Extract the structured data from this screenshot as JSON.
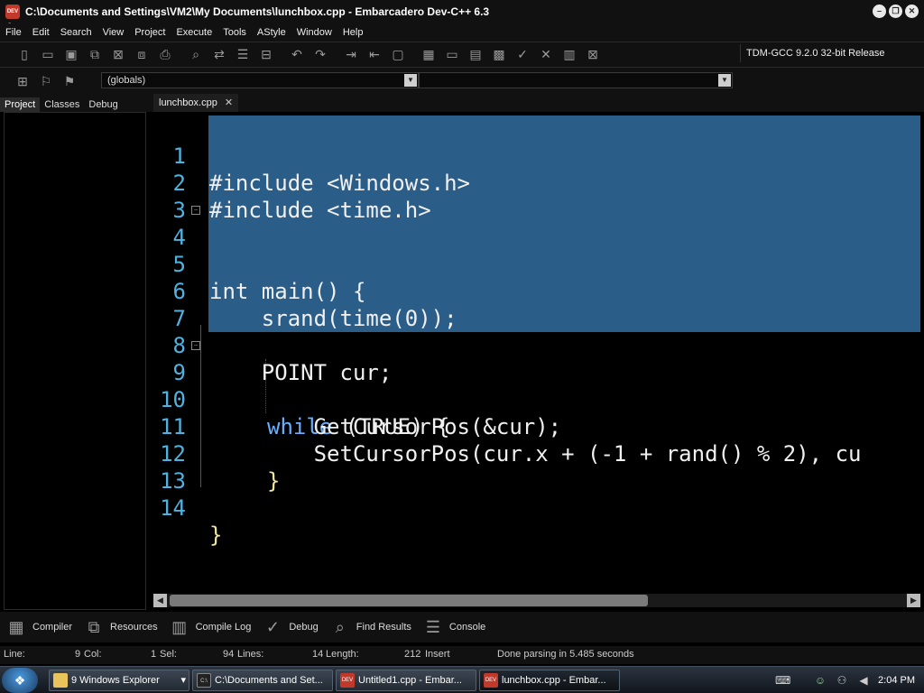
{
  "window": {
    "title": "C:\\Documents and Settings\\VM2\\My Documents\\lunchbox.cpp - Embarcadero Dev-C++ 6.3",
    "app_icon_label": "DEV C++"
  },
  "menu": [
    "File",
    "Edit",
    "Search",
    "View",
    "Project",
    "Execute",
    "Tools",
    "AStyle",
    "Window",
    "Help"
  ],
  "toolbar": {
    "compiler_select": "TDM-GCC 9.2.0 32-bit Release",
    "globals_combo": "(globals)"
  },
  "left_tabs": [
    "Project",
    "Classes",
    "Debug"
  ],
  "editor": {
    "tab_label": "lunchbox.cpp",
    "lines": [
      {
        "n": "1",
        "code": "#include <Windows.h>"
      },
      {
        "n": "2",
        "code": "#include <time.h>"
      },
      {
        "n": "3",
        "code": ""
      },
      {
        "n": "4",
        "code": "int main() {"
      },
      {
        "n": "5",
        "code": ""
      },
      {
        "n": "6",
        "code": "    srand(time(0));"
      },
      {
        "n": "7",
        "code": ""
      },
      {
        "n": "8",
        "code": "    POINT cur;"
      },
      {
        "n": "9",
        "kw": "while",
        "rest": " (TRUE) {"
      },
      {
        "n": "10",
        "code": "        GetCursorPos(&cur);"
      },
      {
        "n": "11",
        "code": "        SetCursorPos(cur.x + (-1 + rand() % 2), cu"
      },
      {
        "n": "12",
        "code": "}"
      },
      {
        "n": "13",
        "code": ""
      },
      {
        "n": "14",
        "code": "}"
      }
    ]
  },
  "bottom_tabs": [
    "Compiler",
    "Resources",
    "Compile Log",
    "Debug",
    "Find Results",
    "Console"
  ],
  "status": {
    "line_label": "Line:",
    "line_value": "9",
    "col_label": "Col:",
    "col_value": "1",
    "sel_label": "Sel:",
    "sel_value": "94",
    "lines_label": "Lines:",
    "lines_value": "14",
    "length_label": "Length:",
    "length_value": "212",
    "mode": "Insert",
    "message": "Done parsing in 5.485 seconds"
  },
  "taskbar": {
    "tasks": [
      "9 Windows Explorer",
      "C:\\Documents and Set...",
      "Untitled1.cpp - Embar...",
      "lunchbox.cpp - Embar..."
    ],
    "clock": "2:04 PM"
  }
}
